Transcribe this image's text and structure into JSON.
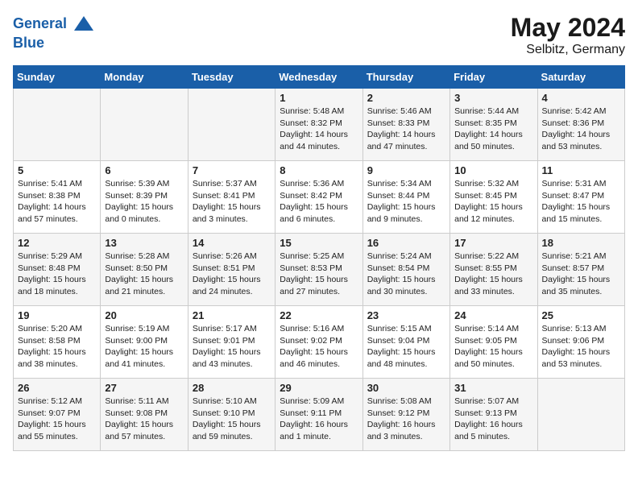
{
  "header": {
    "logo_line1": "General",
    "logo_line2": "Blue",
    "month": "May 2024",
    "location": "Selbitz, Germany"
  },
  "days_of_week": [
    "Sunday",
    "Monday",
    "Tuesday",
    "Wednesday",
    "Thursday",
    "Friday",
    "Saturday"
  ],
  "weeks": [
    [
      {
        "day": "",
        "content": ""
      },
      {
        "day": "",
        "content": ""
      },
      {
        "day": "",
        "content": ""
      },
      {
        "day": "1",
        "content": "Sunrise: 5:48 AM\nSunset: 8:32 PM\nDaylight: 14 hours\nand 44 minutes."
      },
      {
        "day": "2",
        "content": "Sunrise: 5:46 AM\nSunset: 8:33 PM\nDaylight: 14 hours\nand 47 minutes."
      },
      {
        "day": "3",
        "content": "Sunrise: 5:44 AM\nSunset: 8:35 PM\nDaylight: 14 hours\nand 50 minutes."
      },
      {
        "day": "4",
        "content": "Sunrise: 5:42 AM\nSunset: 8:36 PM\nDaylight: 14 hours\nand 53 minutes."
      }
    ],
    [
      {
        "day": "5",
        "content": "Sunrise: 5:41 AM\nSunset: 8:38 PM\nDaylight: 14 hours\nand 57 minutes."
      },
      {
        "day": "6",
        "content": "Sunrise: 5:39 AM\nSunset: 8:39 PM\nDaylight: 15 hours\nand 0 minutes."
      },
      {
        "day": "7",
        "content": "Sunrise: 5:37 AM\nSunset: 8:41 PM\nDaylight: 15 hours\nand 3 minutes."
      },
      {
        "day": "8",
        "content": "Sunrise: 5:36 AM\nSunset: 8:42 PM\nDaylight: 15 hours\nand 6 minutes."
      },
      {
        "day": "9",
        "content": "Sunrise: 5:34 AM\nSunset: 8:44 PM\nDaylight: 15 hours\nand 9 minutes."
      },
      {
        "day": "10",
        "content": "Sunrise: 5:32 AM\nSunset: 8:45 PM\nDaylight: 15 hours\nand 12 minutes."
      },
      {
        "day": "11",
        "content": "Sunrise: 5:31 AM\nSunset: 8:47 PM\nDaylight: 15 hours\nand 15 minutes."
      }
    ],
    [
      {
        "day": "12",
        "content": "Sunrise: 5:29 AM\nSunset: 8:48 PM\nDaylight: 15 hours\nand 18 minutes."
      },
      {
        "day": "13",
        "content": "Sunrise: 5:28 AM\nSunset: 8:50 PM\nDaylight: 15 hours\nand 21 minutes."
      },
      {
        "day": "14",
        "content": "Sunrise: 5:26 AM\nSunset: 8:51 PM\nDaylight: 15 hours\nand 24 minutes."
      },
      {
        "day": "15",
        "content": "Sunrise: 5:25 AM\nSunset: 8:53 PM\nDaylight: 15 hours\nand 27 minutes."
      },
      {
        "day": "16",
        "content": "Sunrise: 5:24 AM\nSunset: 8:54 PM\nDaylight: 15 hours\nand 30 minutes."
      },
      {
        "day": "17",
        "content": "Sunrise: 5:22 AM\nSunset: 8:55 PM\nDaylight: 15 hours\nand 33 minutes."
      },
      {
        "day": "18",
        "content": "Sunrise: 5:21 AM\nSunset: 8:57 PM\nDaylight: 15 hours\nand 35 minutes."
      }
    ],
    [
      {
        "day": "19",
        "content": "Sunrise: 5:20 AM\nSunset: 8:58 PM\nDaylight: 15 hours\nand 38 minutes."
      },
      {
        "day": "20",
        "content": "Sunrise: 5:19 AM\nSunset: 9:00 PM\nDaylight: 15 hours\nand 41 minutes."
      },
      {
        "day": "21",
        "content": "Sunrise: 5:17 AM\nSunset: 9:01 PM\nDaylight: 15 hours\nand 43 minutes."
      },
      {
        "day": "22",
        "content": "Sunrise: 5:16 AM\nSunset: 9:02 PM\nDaylight: 15 hours\nand 46 minutes."
      },
      {
        "day": "23",
        "content": "Sunrise: 5:15 AM\nSunset: 9:04 PM\nDaylight: 15 hours\nand 48 minutes."
      },
      {
        "day": "24",
        "content": "Sunrise: 5:14 AM\nSunset: 9:05 PM\nDaylight: 15 hours\nand 50 minutes."
      },
      {
        "day": "25",
        "content": "Sunrise: 5:13 AM\nSunset: 9:06 PM\nDaylight: 15 hours\nand 53 minutes."
      }
    ],
    [
      {
        "day": "26",
        "content": "Sunrise: 5:12 AM\nSunset: 9:07 PM\nDaylight: 15 hours\nand 55 minutes."
      },
      {
        "day": "27",
        "content": "Sunrise: 5:11 AM\nSunset: 9:08 PM\nDaylight: 15 hours\nand 57 minutes."
      },
      {
        "day": "28",
        "content": "Sunrise: 5:10 AM\nSunset: 9:10 PM\nDaylight: 15 hours\nand 59 minutes."
      },
      {
        "day": "29",
        "content": "Sunrise: 5:09 AM\nSunset: 9:11 PM\nDaylight: 16 hours\nand 1 minute."
      },
      {
        "day": "30",
        "content": "Sunrise: 5:08 AM\nSunset: 9:12 PM\nDaylight: 16 hours\nand 3 minutes."
      },
      {
        "day": "31",
        "content": "Sunrise: 5:07 AM\nSunset: 9:13 PM\nDaylight: 16 hours\nand 5 minutes."
      },
      {
        "day": "",
        "content": ""
      }
    ]
  ]
}
